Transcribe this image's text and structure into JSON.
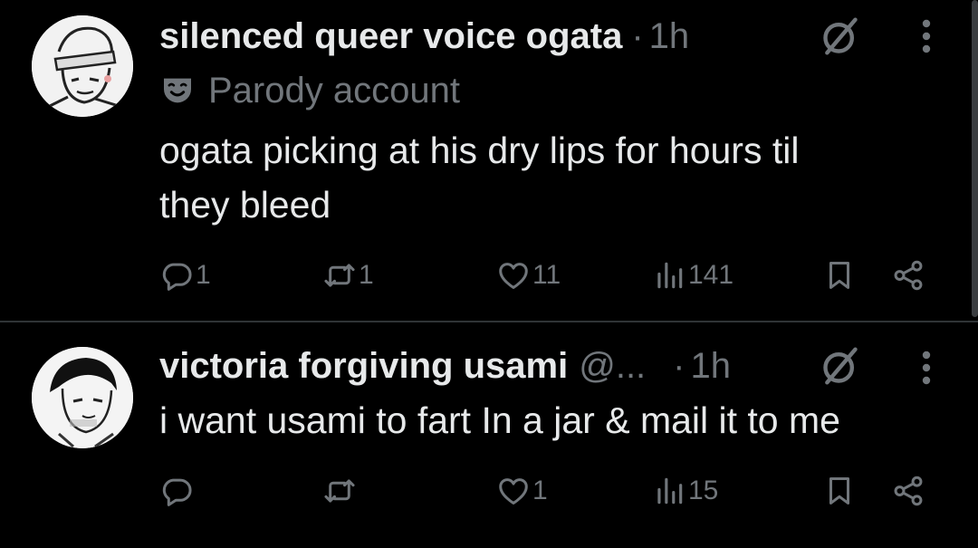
{
  "theme": {
    "background": "#000000",
    "text": "#e7e9ea",
    "muted": "#71767b",
    "divider": "#2f3336"
  },
  "tweets": [
    {
      "display_name": "silenced queer voice ogata",
      "handle": "",
      "separator": "·",
      "time": "1h",
      "badge": {
        "icon": "parody-mask-icon",
        "label": "Parody account"
      },
      "text_lines": [
        "ogata picking at his dry lips for hours til",
        "they bleed"
      ],
      "actions": {
        "replies": "1",
        "reposts": "1",
        "likes": "11",
        "views": "141"
      },
      "icons": [
        "grok-icon",
        "more-icon",
        "reply-icon",
        "repost-icon",
        "like-icon",
        "views-icon",
        "bookmark-icon",
        "share-icon"
      ]
    },
    {
      "display_name": "victoria forgiving usami",
      "handle": "@...",
      "separator": "·",
      "time": "1h",
      "text_lines": [
        "i want usami to fart In a jar & mail it to me"
      ],
      "actions": {
        "replies": "",
        "reposts": "",
        "likes": "1",
        "views": "15"
      },
      "icons": [
        "grok-icon",
        "more-icon",
        "reply-icon",
        "repost-icon",
        "like-icon",
        "views-icon",
        "bookmark-icon",
        "share-icon"
      ]
    }
  ]
}
